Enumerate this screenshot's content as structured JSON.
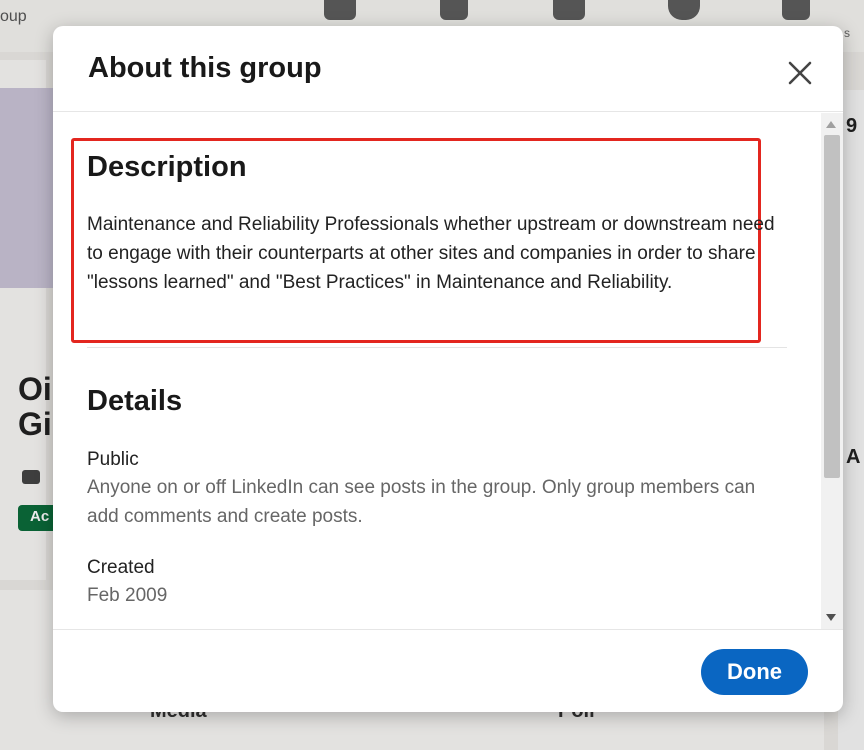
{
  "background": {
    "group_partial": "oup",
    "side_letters": "Oi\nGi",
    "active_badge": "Ac",
    "right_num": "9",
    "right_A": "A",
    "nav_s": "s",
    "media_label": "Media",
    "poll_label": "Poll"
  },
  "modal": {
    "title": "About this group",
    "description": {
      "heading": "Description",
      "text": "Maintenance and Reliability Professionals whether upstream or downstream need to engage with their counterparts at other sites and companies in order to share \"lessons learned\" and \"Best Practices\" in Maintenance and Reliability."
    },
    "details": {
      "heading": "Details",
      "privacy_label": "Public",
      "privacy_text": "Anyone on or off LinkedIn can see posts in the group. Only group members can add comments and create posts.",
      "created_label": "Created",
      "created_value": "Feb 2009"
    },
    "done_label": "Done"
  },
  "colors": {
    "accent": "#0a66c2",
    "highlight_border": "#e3261f"
  }
}
